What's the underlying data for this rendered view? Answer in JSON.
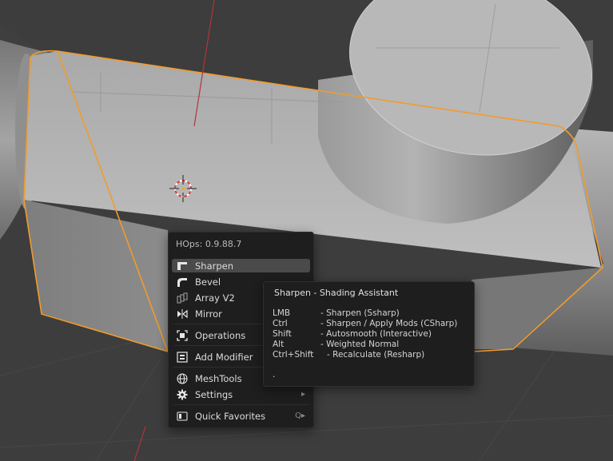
{
  "viewport": {
    "colors": {
      "background": "#3d3d3d",
      "selection_outline": "#f19b2c",
      "z_axis": "#b0353a"
    }
  },
  "menu": {
    "title": "HOps: 0.9.88.7",
    "items": [
      {
        "label": "Sharpen",
        "icon": "sharpen-icon",
        "active": true
      },
      {
        "label": "Bevel",
        "icon": "bevel-icon"
      },
      {
        "label": "Array V2",
        "icon": "array-icon"
      },
      {
        "label": "Mirror",
        "icon": "mirror-icon"
      },
      {
        "label": "Operations",
        "icon": "operations-icon"
      },
      {
        "label": "Add Modifier",
        "icon": "add-modifier-icon"
      },
      {
        "label": "MeshTools",
        "icon": "meshtools-icon"
      },
      {
        "label": "Settings",
        "icon": "gear-icon",
        "submenu": "▸"
      },
      {
        "label": "Quick Favorites",
        "icon": "quick-favorites-icon",
        "shortcut": "Q▸"
      }
    ]
  },
  "tooltip": {
    "title": "Sharpen  -  Shading Assistant",
    "rows": [
      {
        "key": "LMB",
        "desc": "-  Sharpen (Ssharp)"
      },
      {
        "key": "Ctrl",
        "desc": "-  Sharpen / Apply Mods (CSharp)"
      },
      {
        "key": "Shift",
        "desc": "-  Autosmooth (Interactive)"
      },
      {
        "key": "Alt",
        "desc": "-  Weighted Normal"
      },
      {
        "key": "Ctrl+Shift",
        "desc": "-  Recalculate (Resharp)"
      }
    ],
    "footer": "."
  }
}
